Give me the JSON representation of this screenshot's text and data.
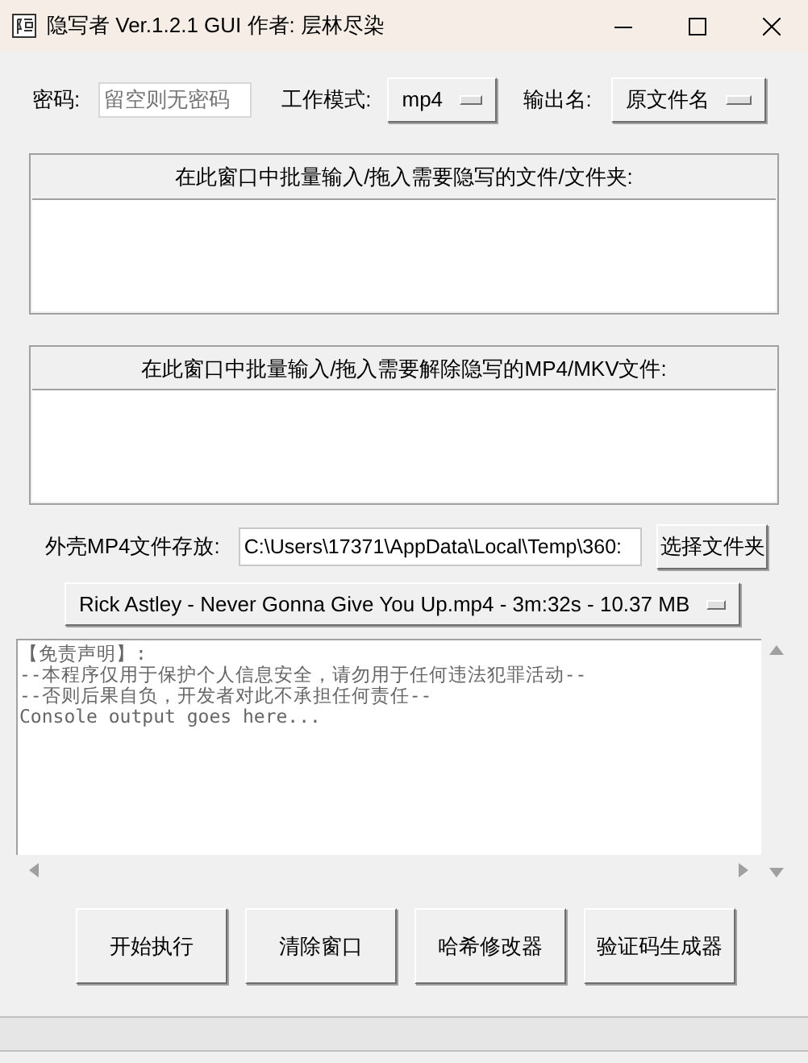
{
  "window": {
    "title": "隐写者 Ver.1.2.1 GUI 作者: 层林尽染"
  },
  "settings": {
    "password": {
      "label": "密码:",
      "placeholder": "留空则无密码"
    },
    "mode": {
      "label": "工作模式:",
      "value": "mp4"
    },
    "output_name": {
      "label": "输出名:",
      "value": "原文件名"
    }
  },
  "drop_zones": [
    {
      "title": "在此窗口中批量输入/拖入需要隐写的文件/文件夹:"
    },
    {
      "title": "在此窗口中批量输入/拖入需要解除隐写的MP4/MKV文件:"
    }
  ],
  "shell_folder": {
    "label": "外壳MP4文件存放:",
    "value": "C:\\Users\\17371\\AppData\\Local\\Temp\\360:",
    "button": "选择文件夹"
  },
  "shell_video": {
    "value": "Rick Astley - Never Gonna Give You Up.mp4 - 3m:32s - 10.37 MB"
  },
  "console": {
    "lines": [
      "【免责声明】:",
      "--本程序仅用于保护个人信息安全，请勿用于任何违法犯罪活动--",
      "--否则后果自负，开发者对此不承担任何责任--",
      "Console output goes here..."
    ]
  },
  "buttons": [
    "开始执行",
    "清除窗口",
    "哈希修改器",
    "验证码生成器"
  ]
}
